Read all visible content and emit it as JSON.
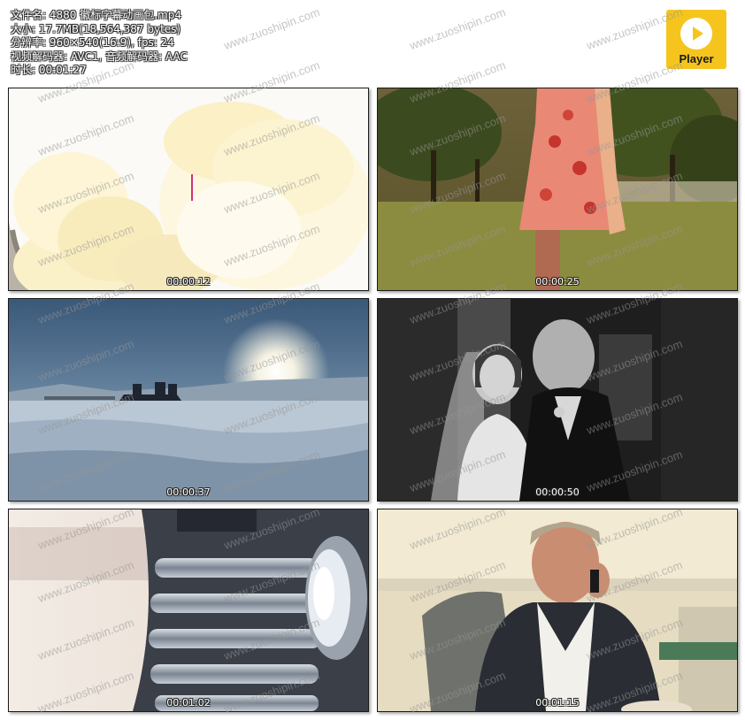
{
  "file_info": {
    "filename": "文件名: 4880 徽标字幕动画包.mp4",
    "size": "大小: 17.7MB(18,564,387 bytes)",
    "resolution": "分辨率: 960×540(16:9), fps: 24",
    "codec": "视频解码器: AVC1, 音频解码器: AAC",
    "duration": "时长: 00:01:27"
  },
  "logo": {
    "label": "Player",
    "icon": "play-icon",
    "color": "#f5c51e"
  },
  "watermark": "www.zuoshipin.com",
  "thumbnails": [
    {
      "name": "ice-cream",
      "timestamp": "00:00:12"
    },
    {
      "name": "woman-dress-park",
      "timestamp": "00:00:25"
    },
    {
      "name": "dog-sled-snow",
      "timestamp": "00:00:37"
    },
    {
      "name": "wedding-couple",
      "timestamp": "00:00:50"
    },
    {
      "name": "vintage-car-grille",
      "timestamp": "00:01:02"
    },
    {
      "name": "man-on-phone",
      "timestamp": "00:01:15"
    }
  ]
}
